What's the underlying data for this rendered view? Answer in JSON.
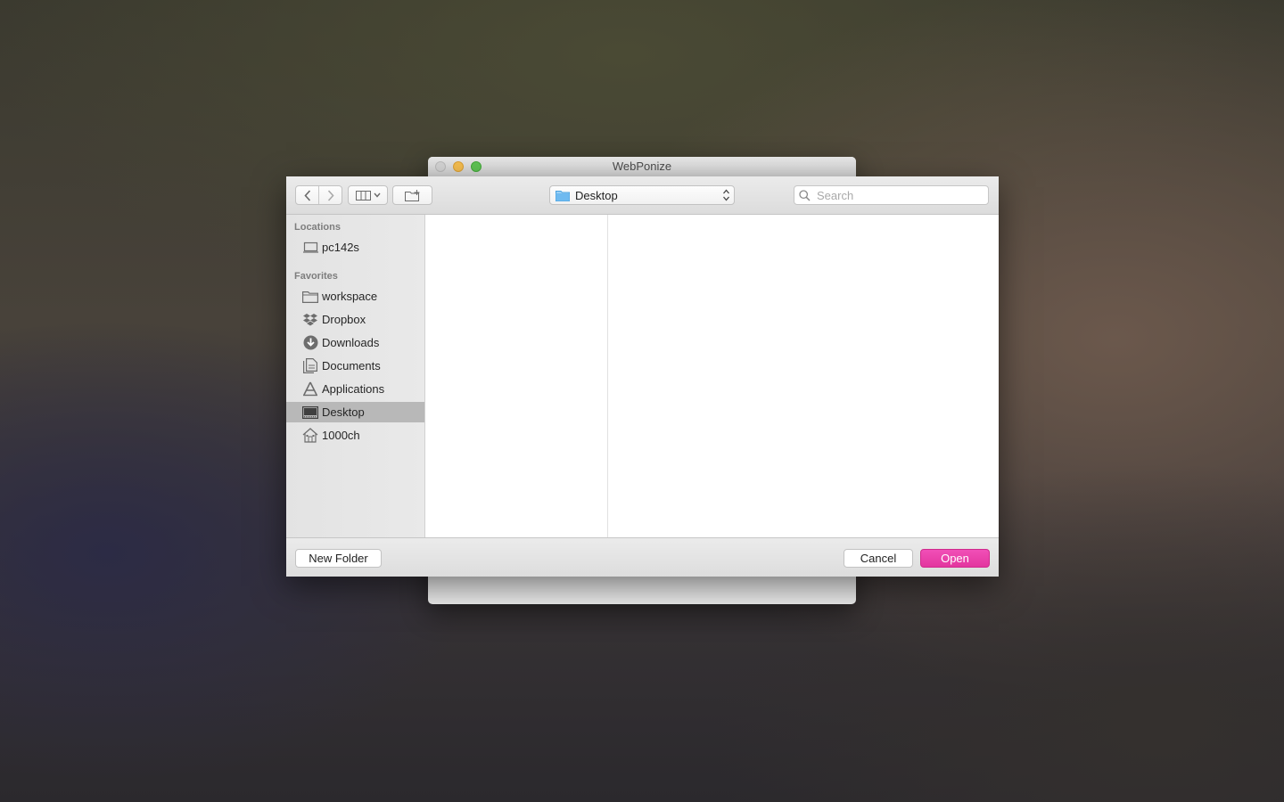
{
  "background_window": {
    "title": "WebPonize"
  },
  "toolbar": {
    "path_popup_label": "Desktop",
    "search_placeholder": "Search"
  },
  "sidebar": {
    "locations_title": "Locations",
    "locations": [
      {
        "label": "pc142s",
        "icon": "computer-icon"
      }
    ],
    "favorites_title": "Favorites",
    "favorites": [
      {
        "label": "workspace",
        "icon": "folder-icon"
      },
      {
        "label": "Dropbox",
        "icon": "dropbox-icon"
      },
      {
        "label": "Downloads",
        "icon": "downloads-icon"
      },
      {
        "label": "Documents",
        "icon": "documents-icon"
      },
      {
        "label": "Applications",
        "icon": "applications-icon"
      },
      {
        "label": "Desktop",
        "icon": "desktop-icon",
        "selected": true
      },
      {
        "label": "1000ch",
        "icon": "home-icon"
      }
    ]
  },
  "buttons": {
    "new_folder": "New Folder",
    "cancel": "Cancel",
    "open": "Open"
  },
  "colors": {
    "accent": "#e93ea8",
    "sidebar_selected": "#b8b8b8"
  }
}
